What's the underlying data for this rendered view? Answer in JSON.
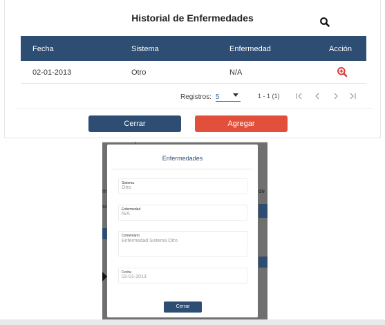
{
  "panel": {
    "title": "Historial de Enfermedades",
    "icons": {
      "search": "search-icon",
      "view": "zoom-in-icon"
    },
    "columns": [
      "Fecha",
      "Sistema",
      "Enfermedad",
      "Acción"
    ],
    "rows": [
      {
        "fecha": "02-01-2013",
        "sistema": "Otro",
        "enfermedad": "N/A"
      }
    ],
    "pager": {
      "label": "Registros:",
      "page_size": "5",
      "range": "1 - 1 (1)",
      "icons": [
        "first-page-icon",
        "prev-page-icon",
        "next-page-icon",
        "last-page-icon"
      ]
    },
    "buttons": {
      "close": "Cerrar",
      "add": "Agregar"
    }
  },
  "background_fragments": [
    "me",
    "sc",
    "de"
  ],
  "modal": {
    "title": "Enfermedades",
    "fields": [
      {
        "label": "Sistema",
        "value": "Otro"
      },
      {
        "label": "Enfermedad",
        "value": "N/A"
      },
      {
        "label": "Comentario",
        "value": "Enfermedad Sistema Otro"
      },
      {
        "label": "Fecha",
        "value": "02-01-2013"
      }
    ],
    "close_label": "Cerrar"
  },
  "colors": {
    "primary": "#2d4d73",
    "danger": "#e2503b",
    "zoom_icon": "#e03a3a"
  }
}
